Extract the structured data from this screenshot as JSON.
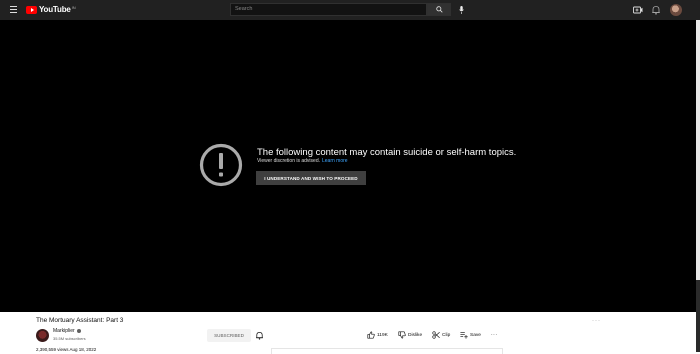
{
  "header": {
    "logo_text": "YouTube",
    "logo_region": "IN",
    "search_placeholder": "Search"
  },
  "player": {
    "warning_title": "The following content may contain suicide or self-harm topics.",
    "warning_subtitle": "Viewer discretion is advised.",
    "learn_more": "Learn more",
    "proceed_button": "I UNDERSTAND AND WISH TO PROCEED"
  },
  "video": {
    "title": "The Mortuary Assistant: Part 3",
    "channel_name": "Markiplier",
    "subscribers": "35.5M subscribers",
    "subscribe_label": "SUBSCRIBED",
    "like_count": "119K",
    "dislike_label": "Dislike",
    "clip_label": "Clip",
    "save_label": "Save",
    "meta": "2,390,559 views  Aug 18, 2022"
  },
  "icons": {
    "menu": "hamburger-icon",
    "search": "search-icon",
    "mic": "mic-icon",
    "create": "create-icon",
    "notifications": "bell-icon",
    "warning": "exclamation-circle-icon",
    "like": "thumbs-up-icon",
    "dislike": "thumbs-down-icon",
    "clip": "scissors-icon",
    "save": "playlist-add-icon",
    "more": "more-horizontal-icon"
  },
  "colors": {
    "brand_red": "#ff0000",
    "topbar_bg": "#212121",
    "player_bg": "#000000",
    "link_blue": "#3ea6ff"
  }
}
